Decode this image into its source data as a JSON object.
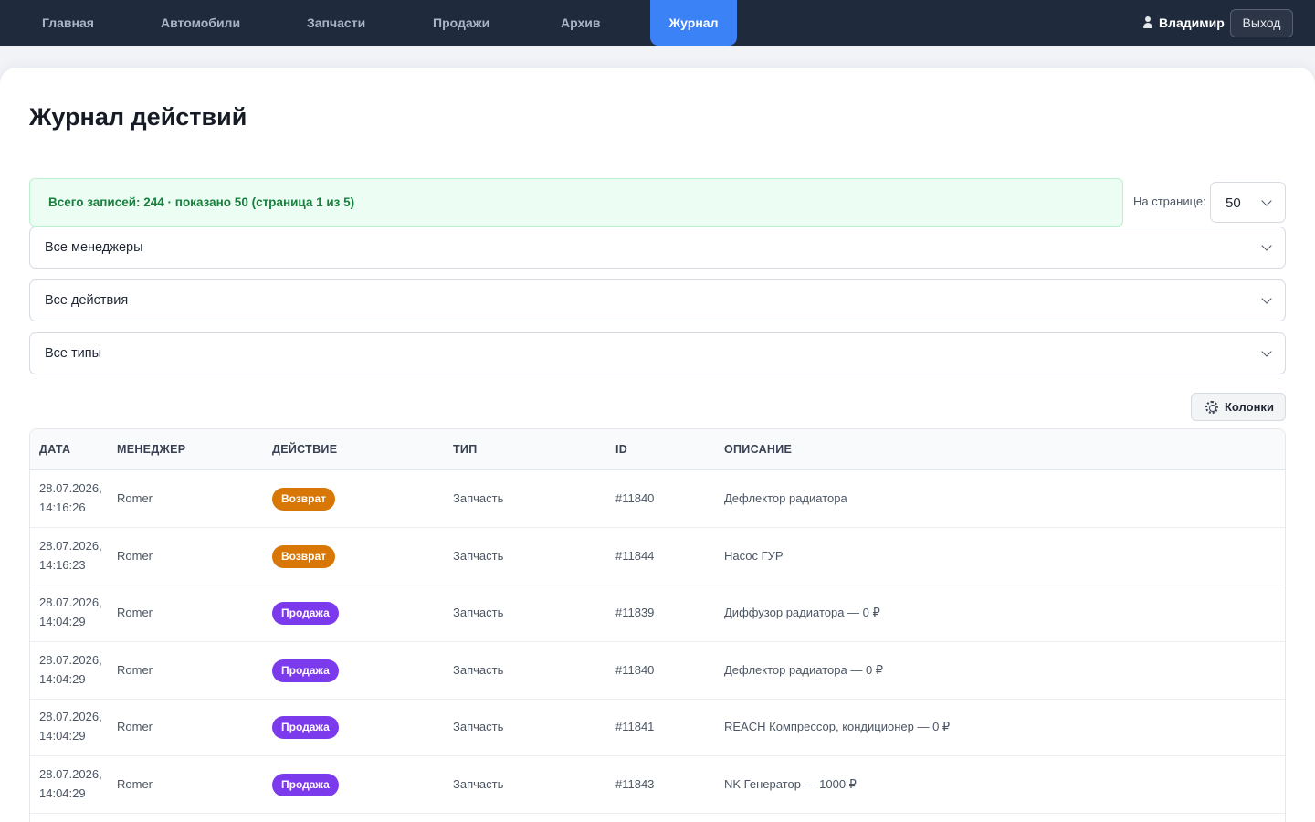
{
  "nav": {
    "items": [
      {
        "label": "Главная",
        "active": false
      },
      {
        "label": "Автомобили",
        "active": false
      },
      {
        "label": "Запчасти",
        "active": false
      },
      {
        "label": "Продажи",
        "active": false
      },
      {
        "label": "Архив",
        "active": false
      },
      {
        "label": "Журнал",
        "active": true
      }
    ],
    "user_name": "Владимир",
    "logout_label": "Выход"
  },
  "page": {
    "title": "Журнал действий",
    "summary": "Всего записей: 244 · показано 50 (страница 1 из 5)",
    "per_page_label": "На странице:",
    "per_page_value": "50"
  },
  "filters": {
    "manager": "Все менеджеры",
    "action": "Все действия",
    "type": "Все типы"
  },
  "columns_button": {
    "label": "Колонки",
    "icon": "gear-icon"
  },
  "table": {
    "headers": [
      "ДАТА",
      "МЕНЕДЖЕР",
      "ДЕЙСТВИЕ",
      "ТИП",
      "ID",
      "ОПИСАНИЕ"
    ],
    "rows": [
      {
        "date": "28.07.2026,",
        "time": "14:16:26",
        "manager": "Romer",
        "action": "Возврат",
        "action_color": "#d97706",
        "type": "Запчасть",
        "id": "#11840",
        "description": "Дефлектор радиатора"
      },
      {
        "date": "28.07.2026,",
        "time": "14:16:23",
        "manager": "Romer",
        "action": "Возврат",
        "action_color": "#d97706",
        "type": "Запчасть",
        "id": "#11844",
        "description": "Насос ГУР"
      },
      {
        "date": "28.07.2026,",
        "time": "14:04:29",
        "manager": "Romer",
        "action": "Продажа",
        "action_color": "#7c3aed",
        "type": "Запчасть",
        "id": "#11839",
        "description": "Диффузор радиатора — 0 ₽"
      },
      {
        "date": "28.07.2026,",
        "time": "14:04:29",
        "manager": "Romer",
        "action": "Продажа",
        "action_color": "#7c3aed",
        "type": "Запчасть",
        "id": "#11840",
        "description": "Дефлектор радиатора — 0 ₽"
      },
      {
        "date": "28.07.2026,",
        "time": "14:04:29",
        "manager": "Romer",
        "action": "Продажа",
        "action_color": "#7c3aed",
        "type": "Запчасть",
        "id": "#11841",
        "description": "REACH Компрессор, кондиционер — 0 ₽"
      },
      {
        "date": "28.07.2026,",
        "time": "14:04:29",
        "manager": "Romer",
        "action": "Продажа",
        "action_color": "#7c3aed",
        "type": "Запчасть",
        "id": "#11843",
        "description": "NK Генератор — 1000 ₽"
      }
    ]
  },
  "colors": {
    "nav_bg": "#1f2a3c",
    "nav_active": "#3b82f6",
    "summary_bg": "#ecfdf3",
    "summary_text": "#17803d",
    "return_badge": "#d97706",
    "sale_badge": "#7c3aed"
  }
}
